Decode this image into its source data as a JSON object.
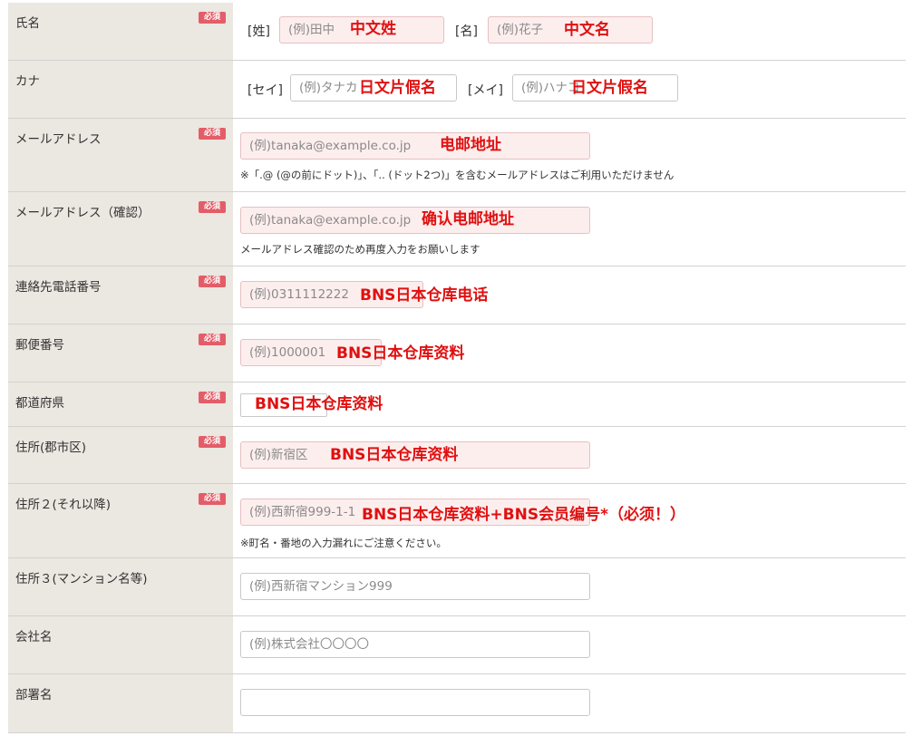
{
  "required_badge": "必須",
  "rows": {
    "name": {
      "label": "氏名",
      "sei_bracket": "[姓]",
      "sei_placeholder": "(例)田中",
      "sei_fill": "中文姓",
      "mei_bracket": "[名]",
      "mei_placeholder": "(例)花子",
      "mei_fill": "中文名"
    },
    "kana": {
      "label": "カナ",
      "sei_bracket": "[セイ]",
      "sei_placeholder": "(例)タナカ",
      "sei_fill": "日文片假名",
      "mei_bracket": "[メイ]",
      "mei_placeholder": "(例)ハナコ",
      "mei_fill": "日文片假名"
    },
    "email": {
      "label": "メールアドレス",
      "placeholder": "(例)tanaka@example.co.jp",
      "fill": "电邮地址",
      "note": "※「.@ (@の前にドット)」、「.. (ドット2つ)」を含むメールアドレスはご利用いただけません"
    },
    "email_confirm": {
      "label": "メールアドレス（確認）",
      "placeholder": "(例)tanaka@example.co.jp",
      "fill": "确认电邮地址",
      "note": "メールアドレス確認のため再度入力をお願いします"
    },
    "phone": {
      "label": "連絡先電話番号",
      "placeholder": "(例)0311112222",
      "fill": "BNS日本仓库电话"
    },
    "postal": {
      "label": "郵便番号",
      "placeholder": "(例)1000001",
      "fill": "BNS日本仓库资料"
    },
    "prefecture": {
      "label": "都道府県",
      "fill": "BNS日本仓库资料"
    },
    "address1": {
      "label": "住所(郡市区)",
      "placeholder": "(例)新宿区",
      "fill": "BNS日本仓库资料"
    },
    "address2": {
      "label": "住所２(それ以降)",
      "placeholder": "(例)西新宿999-1-1",
      "fill": "BNS日本仓库资料+BNS会员编号*（必须！）",
      "note": "※町名・番地の入力漏れにご注意ください。"
    },
    "address3": {
      "label": "住所３(マンション名等)",
      "placeholder": "(例)西新宿マンション999"
    },
    "company": {
      "label": "会社名",
      "placeholder": "(例)株式会社〇〇〇〇"
    },
    "department": {
      "label": "部署名",
      "placeholder": ""
    }
  }
}
